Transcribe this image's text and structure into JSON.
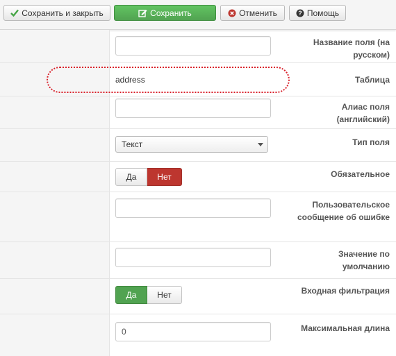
{
  "toolbar": {
    "save_close": {
      "label": "Сохранить и закрыть",
      "icon": "checkmark-icon"
    },
    "save": {
      "label": "Сохранить",
      "icon": "edit-icon"
    },
    "cancel": {
      "label": "Отменить",
      "icon": "close-circle-icon"
    },
    "help": {
      "label": "Помощь",
      "icon": "question-circle-icon"
    }
  },
  "colors": {
    "green": "#51a351",
    "red": "#bd362f",
    "highlight": "#d9202a",
    "label_bg": "#f5f5f5"
  },
  "fields": {
    "name_ru": {
      "label": "Название поля (на русском)",
      "value": "",
      "placeholder": ""
    },
    "table": {
      "label": "Таблица",
      "value": "address"
    },
    "alias": {
      "label": "Алиас поля (английский)",
      "value": "",
      "placeholder": ""
    },
    "type": {
      "label": "Тип поля",
      "selected": "Текст"
    },
    "required": {
      "label": "Обязательное",
      "yes": "Да",
      "no": "Нет",
      "active": "no"
    },
    "error_msg": {
      "label": "Пользовательское сообщение об ошибке",
      "value": "",
      "placeholder": ""
    },
    "default": {
      "label": "Значение по умолчанию",
      "value": "",
      "placeholder": ""
    },
    "input_filter": {
      "label": "Входная фильтрация",
      "yes": "Да",
      "no": "Нет",
      "active": "yes"
    },
    "max_length": {
      "label": "Максимальная длина",
      "value": "0"
    }
  }
}
